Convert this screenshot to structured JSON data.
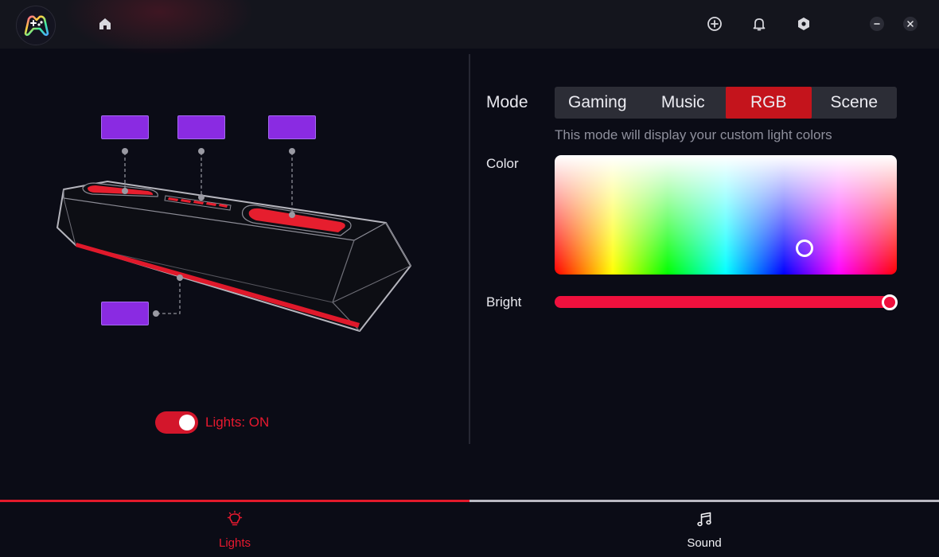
{
  "app": {
    "logo_icon": "gamepad-logo-icon"
  },
  "titlebar": {
    "icons": [
      "home-icon",
      "add-circle-icon",
      "bell-icon",
      "hexagon-settings-icon",
      "minimize-icon",
      "close-icon"
    ]
  },
  "lights_panel": {
    "zones": [
      "zone-top-left",
      "zone-top-center",
      "zone-top-right",
      "zone-front-strip"
    ],
    "zone_color": "#8a2be2",
    "toggle": {
      "on": true,
      "label": "Lights: ON"
    }
  },
  "mode": {
    "label": "Mode",
    "options": [
      "Gaming",
      "Music",
      "RGB",
      "Scene"
    ],
    "selected": "RGB",
    "description": "This mode will display your custom light colors"
  },
  "color": {
    "label": "Color",
    "selected_hue_fraction": 0.73,
    "selected_saturation_fraction": 0.78
  },
  "bright": {
    "label": "Bright",
    "value_fraction": 0.98
  },
  "bottom_tabs": [
    {
      "label": "Lights",
      "icon": "lightbulb-icon",
      "active": true
    },
    {
      "label": "Sound",
      "icon": "music-note-icon",
      "active": false
    }
  ],
  "colors": {
    "accent": "#e21a2b",
    "active_segment": "#c4141c",
    "slider": "#f0103d",
    "background": "#0b0c16"
  }
}
